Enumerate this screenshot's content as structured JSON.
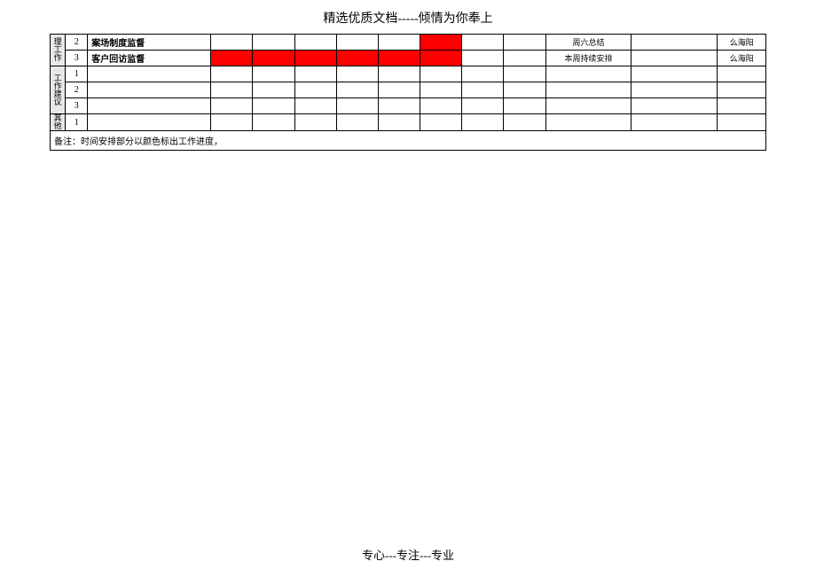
{
  "header": "精选优质文档-----倾情为你奉上",
  "footer": "专心---专注---专业",
  "side_labels": {
    "section1": "理工作",
    "section2": "工作建议",
    "section3": "其他"
  },
  "rows": [
    {
      "num": "2",
      "task": "案场制度监督",
      "cells": [
        "",
        "",
        "",
        "",
        "",
        "red",
        "",
        ""
      ],
      "note": "周六总结",
      "extra": "",
      "person": "么海阳"
    },
    {
      "num": "3",
      "task": "客户回访监督",
      "cells": [
        "red",
        "red",
        "red",
        "red",
        "red",
        "red",
        "",
        ""
      ],
      "note": "本周持续安排",
      "extra": "",
      "person": "么海阳"
    },
    {
      "num": "1",
      "task": "",
      "cells": [
        "",
        "",
        "",
        "",
        "",
        "",
        "",
        ""
      ],
      "note": "",
      "extra": "",
      "person": ""
    },
    {
      "num": "2",
      "task": "",
      "cells": [
        "",
        "",
        "",
        "",
        "",
        "",
        "",
        ""
      ],
      "note": "",
      "extra": "",
      "person": ""
    },
    {
      "num": "3",
      "task": "",
      "cells": [
        "",
        "",
        "",
        "",
        "",
        "",
        "",
        ""
      ],
      "note": "",
      "extra": "",
      "person": ""
    },
    {
      "num": "1",
      "task": "",
      "cells": [
        "",
        "",
        "",
        "",
        "",
        "",
        "",
        ""
      ],
      "note": "",
      "extra": "",
      "person": ""
    }
  ],
  "remark_row": "备注：时间安排部分以颜色标出工作进度，"
}
